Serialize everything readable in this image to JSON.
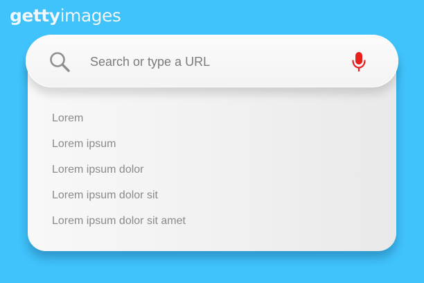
{
  "watermark": {
    "brand_bold": "getty",
    "brand_light": "images"
  },
  "search": {
    "placeholder": "Search or type a URL",
    "value": "",
    "search_icon": "search-icon",
    "mic_icon": "microphone-icon"
  },
  "suggestions": [
    "Lorem",
    "Lorem ipsum",
    "Lorem ipsum dolor",
    "Lorem ipsum dolor sit",
    "Lorem ipsum dolor sit amet"
  ],
  "colors": {
    "background": "#40c3fb",
    "mic": "#e8211f",
    "icon_gray": "#8e8e8e",
    "suggestion_text": "#8a8a8a"
  }
}
